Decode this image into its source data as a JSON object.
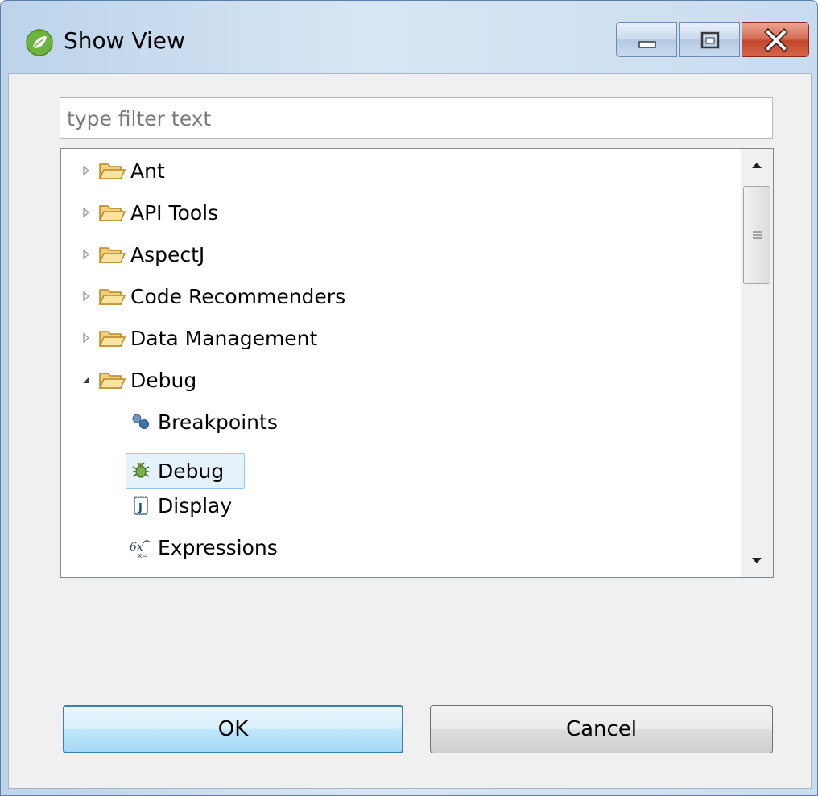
{
  "window": {
    "title": "Show View",
    "icon": "spring-leaf-icon"
  },
  "caption_buttons": {
    "minimize": "minimize-icon",
    "maximize": "maximize-icon",
    "close": "close-icon"
  },
  "filter": {
    "placeholder": "type filter text",
    "value": ""
  },
  "tree": {
    "items": [
      {
        "label": "Ant",
        "type": "folder",
        "expanded": false
      },
      {
        "label": "API Tools",
        "type": "folder",
        "expanded": false
      },
      {
        "label": "AspectJ",
        "type": "folder",
        "expanded": false
      },
      {
        "label": "Code Recommenders",
        "type": "folder",
        "expanded": false
      },
      {
        "label": "Data Management",
        "type": "folder",
        "expanded": false
      },
      {
        "label": "Debug",
        "type": "folder",
        "expanded": true
      },
      {
        "label": "Breakpoints",
        "type": "view",
        "icon": "breakpoints-icon"
      },
      {
        "label": "Debug",
        "type": "view",
        "icon": "bug-icon",
        "selected": true
      },
      {
        "label": "Display",
        "type": "view",
        "icon": "display-icon"
      },
      {
        "label": "Expressions",
        "type": "view",
        "icon": "expressions-icon"
      }
    ]
  },
  "buttons": {
    "ok": "OK",
    "cancel": "Cancel"
  },
  "colors": {
    "selection_bg": "#e5f1fb",
    "selection_border": "#99c7ea",
    "folder": "#e8b54a",
    "default_button_border": "#3c7fb1"
  }
}
